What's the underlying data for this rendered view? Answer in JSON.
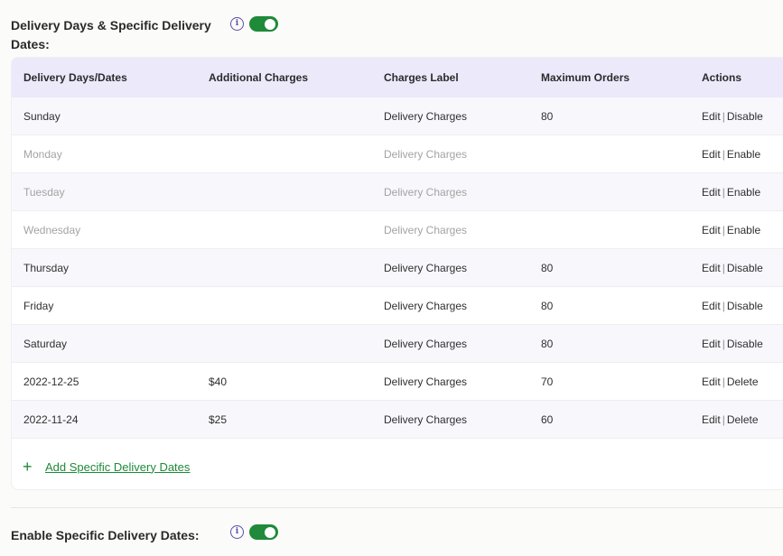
{
  "delivery_section": {
    "title": "Delivery Days & Specific Delivery Dates:",
    "info_icon": "info-icon",
    "toggle_on": true
  },
  "table": {
    "headers": [
      "Delivery Days/Dates",
      "Additional Charges",
      "Charges Label",
      "Maximum Orders",
      "Actions"
    ],
    "rows": [
      {
        "day": "Sunday",
        "charges": "",
        "label": "Delivery Charges",
        "max": "80",
        "edit": "Edit",
        "sep": "|",
        "action": "Disable"
      },
      {
        "day": "Monday",
        "charges": "",
        "label": "Delivery Charges",
        "max": "",
        "edit": "Edit",
        "sep": "|",
        "action": "Enable"
      },
      {
        "day": "Tuesday",
        "charges": "",
        "label": "Delivery Charges",
        "max": "",
        "edit": "Edit",
        "sep": "|",
        "action": "Enable"
      },
      {
        "day": "Wednesday",
        "charges": "",
        "label": "Delivery Charges",
        "max": "",
        "edit": "Edit",
        "sep": "|",
        "action": "Enable"
      },
      {
        "day": "Thursday",
        "charges": "",
        "label": "Delivery Charges",
        "max": "80",
        "edit": "Edit",
        "sep": "|",
        "action": "Disable"
      },
      {
        "day": "Friday",
        "charges": "",
        "label": "Delivery Charges",
        "max": "80",
        "edit": "Edit",
        "sep": "|",
        "action": "Disable"
      },
      {
        "day": "Saturday",
        "charges": "",
        "label": "Delivery Charges",
        "max": "80",
        "edit": "Edit",
        "sep": "|",
        "action": "Disable"
      },
      {
        "day": "2022-12-25",
        "charges": "$40",
        "label": "Delivery Charges",
        "max": "70",
        "edit": "Edit",
        "sep": "|",
        "action": "Delete"
      },
      {
        "day": "2022-11-24",
        "charges": "$25",
        "label": "Delivery Charges",
        "max": "60",
        "edit": "Edit",
        "sep": "|",
        "action": "Delete"
      }
    ],
    "add_button": {
      "icon": "+",
      "label": "Add Specific Delivery Dates"
    }
  },
  "specific_dates_section": {
    "title": "Enable Specific Delivery Dates:",
    "info_icon": "info-icon",
    "toggle_on": true
  },
  "colors": {
    "accent_green": "#1e8a3a",
    "header_bg": "#ece9fb",
    "action_link": "#4a3f8c",
    "disabled_text": "#a3a3a3"
  }
}
